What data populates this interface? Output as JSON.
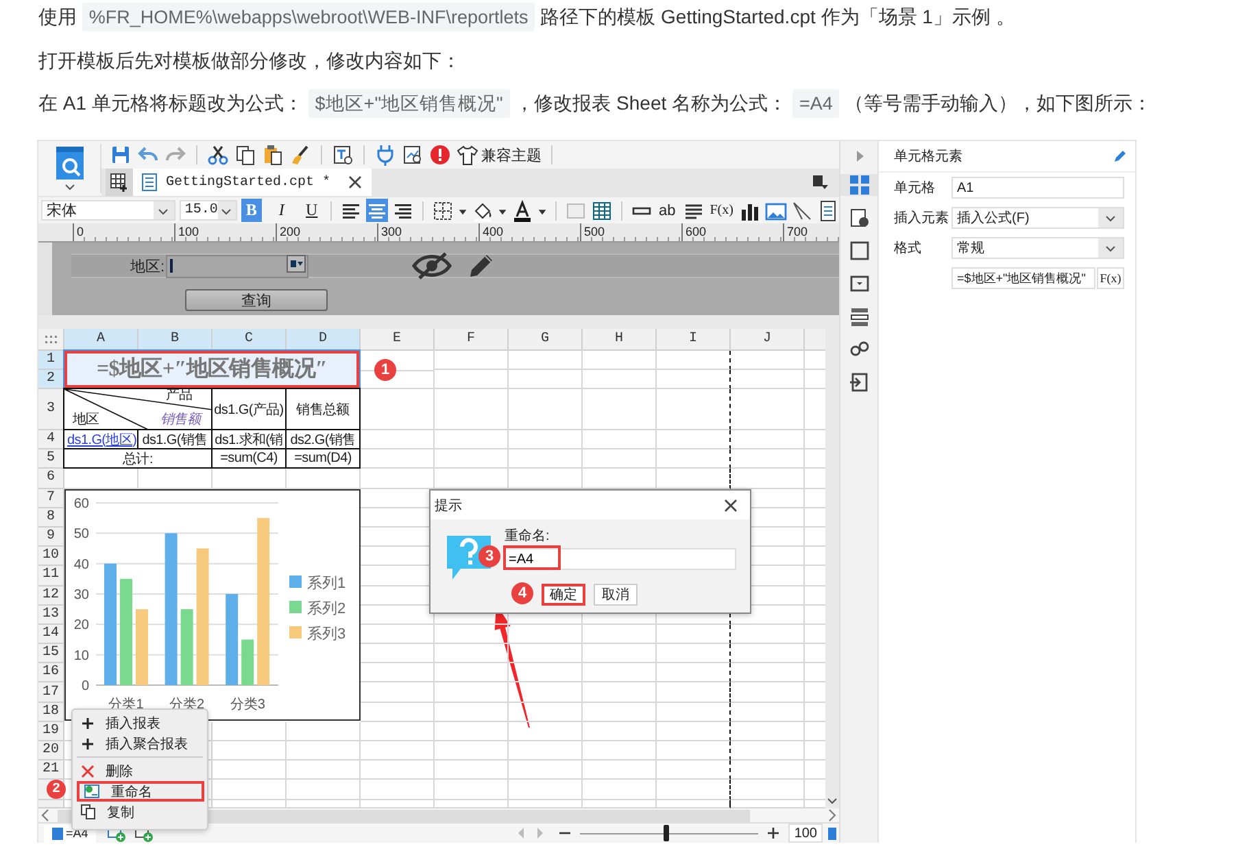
{
  "intro": [
    {
      "segments": [
        {
          "kind": "text",
          "text": "使用 "
        },
        {
          "kind": "code",
          "text": "%FR_HOME%\\webapps\\webroot\\WEB-INF\\reportlets"
        },
        {
          "kind": "text",
          "text": " 路径下的模板 GettingStarted.cpt 作为「场景 1」示例 。"
        }
      ]
    },
    {
      "segments": [
        {
          "kind": "text",
          "text": "打开模板后先对模板做部分修改，修改内容如下："
        }
      ]
    },
    {
      "segments": [
        {
          "kind": "text",
          "text": "在 A1 单元格将标题改为公式： "
        },
        {
          "kind": "code",
          "text": "$地区+\"地区销售概况\""
        },
        {
          "kind": "text",
          "text": " ，修改报表 Sheet 名称为公式： "
        },
        {
          "kind": "code",
          "text": "=A4"
        },
        {
          "kind": "text",
          "text": " （等号需手动输入），如下图所示："
        }
      ]
    }
  ],
  "toolbar": {
    "theme_button": "兼容主题",
    "tab_title": "GettingStarted.cpt *"
  },
  "format_bar": {
    "font": "宋体",
    "size": "15.0",
    "styles": [
      {
        "label": "B",
        "selected": true
      },
      {
        "label": "I",
        "selected": false
      },
      {
        "label": "U",
        "selected": false
      }
    ],
    "align": [
      {
        "selected": false
      },
      {
        "selected": true
      },
      {
        "selected": false
      }
    ],
    "wrap_label": "ab",
    "formula_label": "F(x)"
  },
  "ruler": [
    "0",
    "100",
    "200",
    "300",
    "400",
    "500",
    "600",
    "700"
  ],
  "parameters": {
    "label": "地区:",
    "button": "查询"
  },
  "sheet": {
    "columns": [
      {
        "label": "A",
        "selected": true
      },
      {
        "label": "B",
        "selected": true
      },
      {
        "label": "C",
        "selected": true
      },
      {
        "label": "D",
        "selected": true
      },
      {
        "label": "E",
        "selected": false
      },
      {
        "label": "F",
        "selected": false
      },
      {
        "label": "G",
        "selected": false
      },
      {
        "label": "H",
        "selected": false
      },
      {
        "label": "I",
        "selected": false
      },
      {
        "label": "J",
        "selected": false
      }
    ],
    "rows": [
      {
        "label": "1",
        "selected": true
      },
      {
        "label": "2",
        "selected": true
      },
      {
        "label": "3",
        "selected": false
      },
      {
        "label": "4",
        "selected": false
      },
      {
        "label": "5",
        "selected": false
      },
      {
        "label": "6",
        "selected": false
      },
      {
        "label": "7",
        "selected": false
      },
      {
        "label": "8",
        "selected": false
      },
      {
        "label": "9",
        "selected": false
      },
      {
        "label": "10",
        "selected": false
      },
      {
        "label": "11",
        "selected": false
      },
      {
        "label": "12",
        "selected": false
      },
      {
        "label": "13",
        "selected": false
      },
      {
        "label": "14",
        "selected": false
      },
      {
        "label": "15",
        "selected": false
      },
      {
        "label": "16",
        "selected": false
      },
      {
        "label": "17",
        "selected": false
      },
      {
        "label": "18",
        "selected": false
      },
      {
        "label": "19",
        "selected": false
      },
      {
        "label": "20",
        "selected": false
      },
      {
        "label": "21",
        "selected": false
      }
    ],
    "title_cell": {
      "text": "=$地区+″地区销售概况″",
      "highlighted": true
    },
    "corner": {
      "top": "产品",
      "bottom": "地区",
      "middle": "销售额"
    },
    "header_cells": [
      "ds1.G(产品)",
      "销售总额"
    ],
    "data_cells": [
      {
        "kind": "link",
        "text": "ds1.G(地区)"
      },
      {
        "kind": "plain",
        "text": "ds1.G(销售"
      },
      {
        "kind": "plain",
        "text": "ds1.求和(销"
      },
      {
        "kind": "plain",
        "text": "ds2.G(销售"
      }
    ],
    "total_label": "总计:",
    "total_cells": [
      "=sum(C4)",
      "=sum(D4)"
    ],
    "chart_data": {
      "type": "bar",
      "categories": [
        "分类1",
        "分类2",
        "分类3"
      ],
      "series": [
        {
          "name": "系列1",
          "color": "#5eaeea",
          "values": [
            40,
            50,
            30
          ]
        },
        {
          "name": "系列2",
          "color": "#78d98f",
          "values": [
            35,
            25,
            15
          ]
        },
        {
          "name": "系列3",
          "color": "#f6c97d",
          "values": [
            25,
            45,
            55
          ]
        }
      ],
      "ylim": [
        0,
        60
      ],
      "yticks": [
        0,
        10,
        20,
        30,
        40,
        50,
        60
      ],
      "grid": true,
      "legend": "right"
    }
  },
  "context_menu": [
    {
      "kind": "add",
      "label": "插入报表",
      "highlighted": false
    },
    {
      "kind": "add",
      "label": "插入聚合报表",
      "highlighted": false
    },
    {
      "kind": "separator"
    },
    {
      "kind": "remove",
      "label": "删除",
      "highlighted": false
    },
    {
      "kind": "rename",
      "label": "重命名",
      "highlighted": true
    },
    {
      "kind": "copy",
      "label": "复制",
      "highlighted": false
    }
  ],
  "dialog": {
    "title": "提示",
    "label": "重命名:",
    "value": "=A4",
    "value_highlighted": true,
    "buttons": [
      {
        "label": "确定",
        "highlighted": true
      },
      {
        "label": "取消",
        "highlighted": false
      }
    ]
  },
  "badges": [
    "1",
    "2",
    "3",
    "4"
  ],
  "status_bar": {
    "sheet_tab": "=A4",
    "zoom": {
      "level": 0.48
    },
    "zoom_value": "100"
  },
  "side_strip": [
    {
      "selected": true
    },
    {
      "selected": false
    },
    {
      "selected": false
    },
    {
      "selected": false
    },
    {
      "selected": false
    },
    {
      "selected": false
    },
    {
      "selected": false
    }
  ],
  "properties": {
    "title": "单元格元素",
    "fields": [
      {
        "kind": "text",
        "label": "单元格",
        "value": "A1"
      },
      {
        "kind": "select",
        "label": "插入元素",
        "value": "插入公式(F)"
      },
      {
        "kind": "select",
        "label": "格式",
        "value": "常规"
      },
      {
        "kind": "formula",
        "value": "=$地区+\"地区销售概况\"",
        "button": "F(x)"
      }
    ]
  }
}
